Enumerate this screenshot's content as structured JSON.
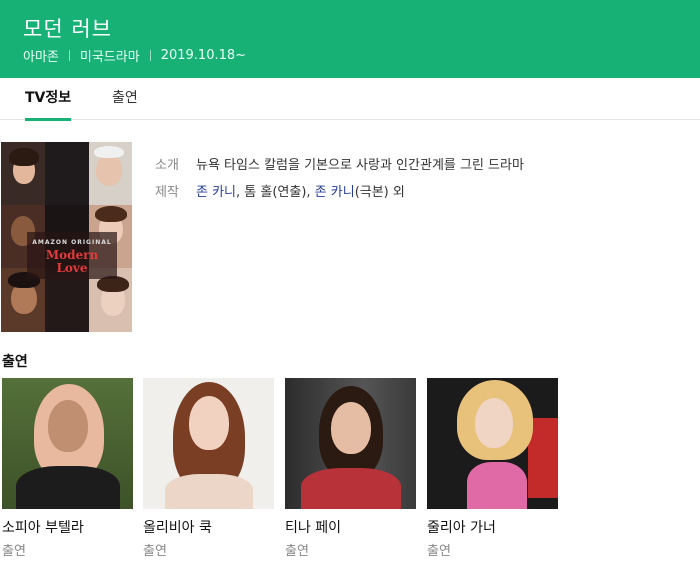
{
  "header": {
    "title": "모던 러브",
    "meta": [
      "아마존",
      "미국드라마",
      "2019.10.18~"
    ]
  },
  "tabs": [
    {
      "label": "TV정보",
      "active": true
    },
    {
      "label": "출연",
      "active": false
    }
  ],
  "poster": {
    "brand": "AMAZON ORIGINAL",
    "title_line1": "Modern",
    "title_line2": "Love"
  },
  "info": {
    "intro_label": "소개",
    "intro_text": "뉴욕 타임스 칼럼을 기본으로 사랑과 인간관계를 그린 드라마",
    "production_label": "제작",
    "production": {
      "director_link": "존 카니",
      "sep1": ", 톰 홀(연출), ",
      "writer_link": "존 카니",
      "tail": "(극본) 외"
    }
  },
  "cast_section": {
    "title": "출연",
    "members": [
      {
        "name": "소피아 부텔라",
        "role": "출연"
      },
      {
        "name": "올리비아 쿡",
        "role": "출연"
      },
      {
        "name": "티나 페이",
        "role": "출연"
      },
      {
        "name": "줄리아 가너",
        "role": "출연"
      }
    ]
  },
  "colors": {
    "brand_green": "#17b176",
    "link_blue": "#253c9c"
  }
}
